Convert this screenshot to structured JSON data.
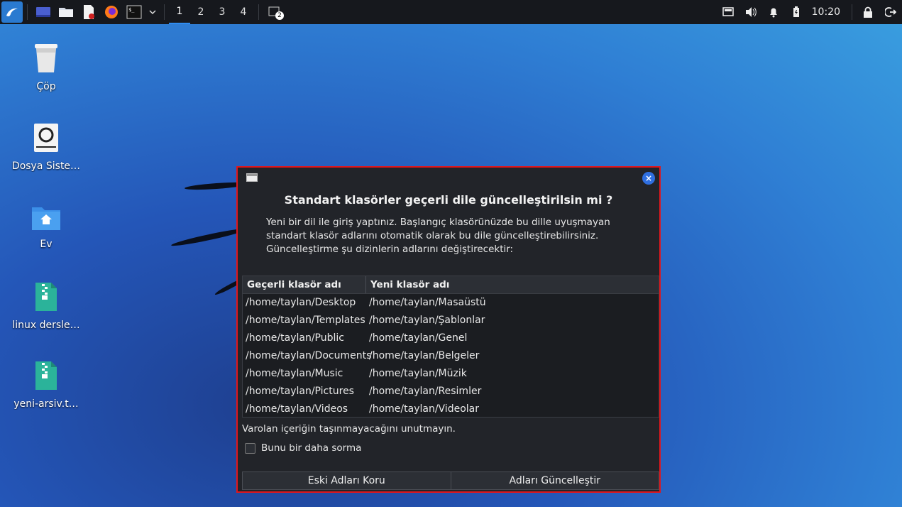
{
  "panel": {
    "workspaces": [
      "1",
      "2",
      "3",
      "4"
    ],
    "active_workspace": "1",
    "window_count_badge": "2",
    "clock": "10:20"
  },
  "desktop": {
    "icons": [
      {
        "label": "Çöp",
        "icon": "trash-icon"
      },
      {
        "label": "Dosya Siste…",
        "icon": "drive-icon"
      },
      {
        "label": "Ev",
        "icon": "home-folder-icon"
      },
      {
        "label": "linux dersle…",
        "icon": "zip-archive-icon"
      },
      {
        "label": "yeni-arsiv.t…",
        "icon": "zip-archive-icon"
      }
    ]
  },
  "dialog": {
    "title": "Standart klasörler geçerli dile güncelleştirilsin mi ?",
    "description": "Yeni bir dil ile giriş yaptınız. Başlangıç klasörünüzde bu dille uyuşmayan standart klasör adlarını otomatik olarak bu dile güncelleştirebilirsiniz. Güncelleştirme şu dizinlerin adlarını değiştirecektir:",
    "table": {
      "headers": [
        "Geçerli klasör adı",
        "Yeni klasör adı"
      ],
      "rows": [
        [
          "/home/taylan/Desktop",
          "/home/taylan/Masaüstü"
        ],
        [
          "/home/taylan/Templates",
          "/home/taylan/Şablonlar"
        ],
        [
          "/home/taylan/Public",
          "/home/taylan/Genel"
        ],
        [
          "/home/taylan/Documents",
          "/home/taylan/Belgeler"
        ],
        [
          "/home/taylan/Music",
          "/home/taylan/Müzik"
        ],
        [
          "/home/taylan/Pictures",
          "/home/taylan/Resimler"
        ],
        [
          "/home/taylan/Videos",
          "/home/taylan/Videolar"
        ]
      ]
    },
    "note": "Varolan içeriğin taşınmayacağını unutmayın.",
    "checkbox_label": "Bunu bir daha sorma",
    "keep_button": "Eski Adları Koru",
    "update_button": "Adları Güncelleştir",
    "close_symbol": "×"
  }
}
